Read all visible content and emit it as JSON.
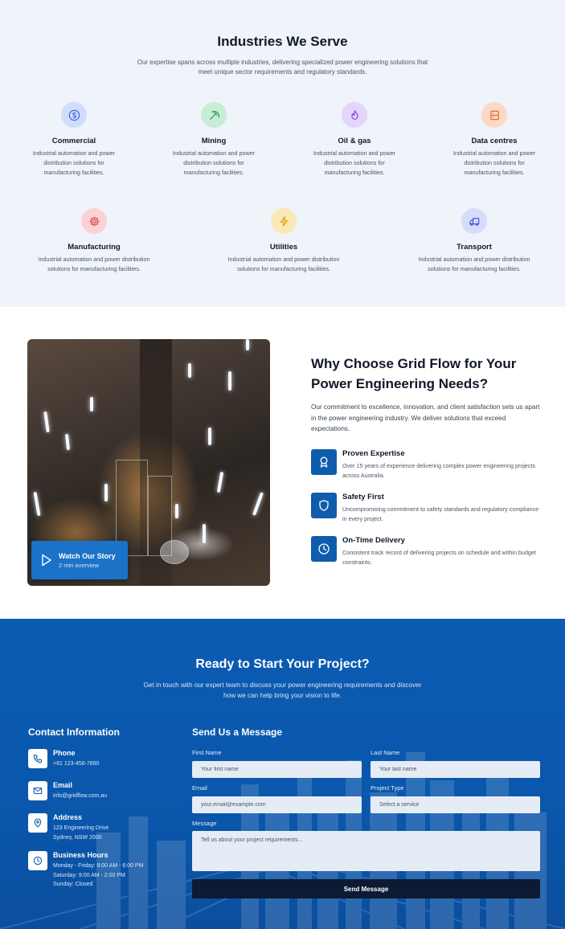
{
  "industries": {
    "title": "Industries We Serve",
    "subtitle": "Our expertise spans across multiple industries, delivering specialized power engineering solutions that meet unique sector requirements and regulatory standards.",
    "row1": [
      {
        "name": "Commercial",
        "description": "Industrial automation and power distribution solutions for manufacturing facilities.",
        "icon": "dollar-icon",
        "bg": "#cfdefc",
        "fg": "#3f6ad8"
      },
      {
        "name": "Mining",
        "description": "Industrial automation and power distribution solutions for manufacturing facilities.",
        "icon": "pickaxe-icon",
        "bg": "#c9ecd6",
        "fg": "#2f9e58"
      },
      {
        "name": "Oil & gas",
        "description": "Industrial automation and power distribution solutions for manufacturing facilities.",
        "icon": "flame-icon",
        "bg": "#e3d5fb",
        "fg": "#8b4fe0"
      },
      {
        "name": "Data centres",
        "description": "Industrial automation and power distribution solutions for manufacturing facilities.",
        "icon": "server-icon",
        "bg": "#fbd9c6",
        "fg": "#e26d2f"
      }
    ],
    "row2": [
      {
        "name": "Manufacturing",
        "description": "Industrial automation and power distribution solutions for manufacturing facilities.",
        "icon": "gear-icon",
        "bg": "#fbd2d4",
        "fg": "#e0414b"
      },
      {
        "name": "Utilities",
        "description": "Industrial automation and power distribution solutions for manufacturing facilities.",
        "icon": "bolt-icon",
        "bg": "#fae8b8",
        "fg": "#e1a713"
      },
      {
        "name": "Transport",
        "description": "Industrial automation and power distribution solutions for manufacturing facilities.",
        "icon": "truck-icon",
        "bg": "#d8dcfb",
        "fg": "#4c57d6"
      }
    ]
  },
  "why": {
    "title": "Why Choose Grid Flow for Your Power Engineering Needs?",
    "description": "Our commitment to excellence, innovation, and client satisfaction sets us apart in the power engineering industry. We deliver solutions that exceed expectations.",
    "watch_title": "Watch Our Story",
    "watch_sub": "2 min overview",
    "features": [
      {
        "title": "Proven Expertise",
        "description": "Over 15 years of experience delivering complex power engineering projects across Australia.",
        "icon": "award-icon"
      },
      {
        "title": "Safety First",
        "description": "Uncompromising commitment to safety standards and regulatory compliance in every project.",
        "icon": "shield-icon"
      },
      {
        "title": "On-Time Delivery",
        "description": "Consistent track record of delivering projects on schedule and within budget constraints.",
        "icon": "clock-icon"
      }
    ]
  },
  "contact": {
    "title": "Ready to Start Your Project?",
    "subtitle": "Get in touch with our expert team to discuss your power engineering requirements and discover how we can help bring your vision to life.",
    "info_title": "Contact Information",
    "phone_label": "Phone",
    "phone_value": "+61 123-456-7890",
    "email_label": "Email",
    "email_value": "info@gridflow.com.au",
    "address_label": "Address",
    "address_line1": "123 Engineering Drive",
    "address_line2": "Sydney, NSW 2000",
    "hours_label": "Business Hours",
    "hours_line1": "Monday - Friday: 8:00 AM - 6:00 PM",
    "hours_line2": "Saturday: 9:00 AM - 2:00 PM",
    "hours_line3": "Sunday: Closed",
    "form_title": "Send Us a Message",
    "first_name_label": "First Name",
    "first_name_placeholder": "Your first name",
    "last_name_label": "Last Name",
    "last_name_placeholder": "Your last name",
    "email_field_label": "Email",
    "email_field_placeholder": "your.email@example.com",
    "project_type_label": "Project Type",
    "project_type_value": "Select a service",
    "message_label": "Message",
    "message_placeholder": "Tell us about your project requirements...",
    "send_label": "Send Message"
  }
}
